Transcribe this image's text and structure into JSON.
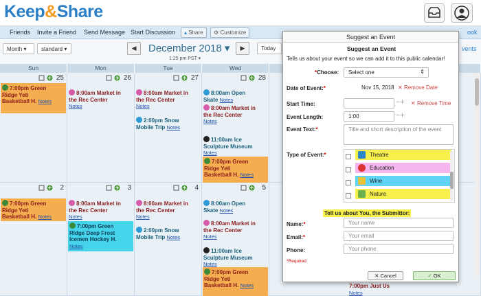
{
  "header": {
    "logo_part1": "Keep",
    "logo_amp": "&",
    "logo_part2": "Share"
  },
  "nav": {
    "friends": "Friends",
    "invite": "Invite a Friend",
    "send": "Send Message",
    "start": "Start Discussion",
    "share": "Share",
    "customize": "Customize",
    "right": "ook"
  },
  "controls": {
    "view_select": "Month",
    "style_select": "standard",
    "month_label": "December 2018",
    "today": "Today",
    "timezone": "1:25 pm PST",
    "right": "vents",
    "prev": "◀",
    "next": "▶"
  },
  "days": [
    "Sun",
    "Mon",
    "Tue",
    "Wed"
  ],
  "week1": {
    "dates": [
      "25",
      "26",
      "27",
      "28"
    ],
    "sun": {
      "line1": "7:00pm Green",
      "line2": "Ridge Yeti",
      "line3": "Basketball H.",
      "notes": "Notes"
    },
    "mon": {
      "line1": "8:00am Market in",
      "line2": "the Rec Center",
      "notes": "Notes"
    },
    "tue": {
      "line1": "8:00am Market in",
      "line2": "the Rec Center",
      "notes": "Notes",
      "e2_line1": "2:00pm Snow",
      "e2_line2": "Mobile Trip",
      "e2_notes": "Notes"
    },
    "wed": {
      "e1_line1": "8:00am Open",
      "e1_line2": "Skate",
      "e1_notes": "Notes",
      "e2_line1": "8:00am Market in",
      "e2_line2": "the Rec Center",
      "e2_notes": "Notes",
      "e3_line1": "11:00am Ice",
      "e3_line2": "Sculpture Museum",
      "e3_notes": "Notes",
      "e4_line1": "7:00pm Green",
      "e4_line2": "Ridge Yeti",
      "e4_line3": "Basketball H.",
      "e4_notes": "Notes"
    }
  },
  "week2": {
    "dates": [
      "2",
      "3",
      "4",
      "5"
    ],
    "sun": {
      "line1": "7:00pm Green",
      "line2": "Ridge Yeti",
      "line3": "Basketball H.",
      "notes": "Notes"
    },
    "mon": {
      "line1": "8:00am Market in",
      "line2": "the Rec Center",
      "notes": "Notes",
      "e2_line1": "7:00pm Green",
      "e2_line2": "Ridge Deep Frost",
      "e2_line3": "Icemen Hockey H.",
      "e2_notes": "Notes"
    },
    "tue": {
      "line1": "8:00am Market in",
      "line2": "the Rec Center",
      "notes": "Notes",
      "e2_line1": "2:00pm Snow",
      "e2_line2": "Mobile Trip",
      "e2_notes": "Notes"
    },
    "wed": {
      "e1_line1": "8:00am Open",
      "e1_line2": "Skate",
      "e1_notes": "Notes",
      "e2_line1": "8:00am Market in",
      "e2_line2": "the Rec Center",
      "e2_notes": "Notes",
      "e3_line1": "11:00am Ice",
      "e3_line2": "Sculpture Museum",
      "e3_notes": "Notes",
      "e4_line1": "7:00pm Green",
      "e4_line2": "Ridge Yeti",
      "e4_line3": "Basketball H.",
      "e4_notes": "Notes"
    }
  },
  "peek": {
    "line1": "7:00pm Just Us",
    "notes": "Notes"
  },
  "dialog": {
    "title": "Suggest an Event",
    "subtitle": "Suggest an Event",
    "intro": "Tells us about your event so we can add it to this public calendar!",
    "choose_label": "Choose:",
    "choose_value": "Select one",
    "date_label": "Date of Event:",
    "date_value": "Nov 15, 2018",
    "remove_date": "Remove Date",
    "start_label": "Start Time:",
    "remove_time": "Remove Time",
    "length_label": "Event Length:",
    "length_value": "1:00",
    "text_label": "Event Text:",
    "text_placeholder": "Title and short description of the event",
    "type_label": "Type of Event:",
    "types": [
      "Theatre",
      "Education",
      "Wine",
      "Nature"
    ],
    "submitter_heading": "Tell us about You, the Submittor:",
    "name_label": "Name:",
    "name_placeholder": "Your name",
    "email_label": "Email:",
    "email_placeholder": "Your email",
    "phone_label": "Phone:",
    "phone_placeholder": "Your phone",
    "required_note": "*Required",
    "cancel": "Cancel",
    "ok": "OK"
  },
  "colors": {
    "orange": "#f4ad4f",
    "cyan": "#46d4ea",
    "theatre": "#f7f04a",
    "education": "#f5b6ee",
    "wine": "#5fd4f5",
    "nature": "#f7f04a"
  }
}
